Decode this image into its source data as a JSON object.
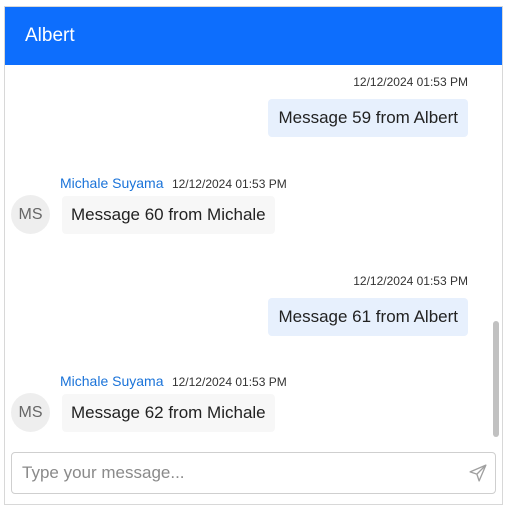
{
  "header": {
    "title": "Albert"
  },
  "messages": [
    {
      "direction": "outgoing",
      "timestamp": "12/12/2024 01:53 PM",
      "text": "Message 59 from Albert"
    },
    {
      "direction": "incoming",
      "sender": "Michale Suyama",
      "initials": "MS",
      "timestamp": "12/12/2024 01:53 PM",
      "text": "Message 60 from Michale"
    },
    {
      "direction": "outgoing",
      "timestamp": "12/12/2024 01:53 PM",
      "text": "Message 61 from Albert"
    },
    {
      "direction": "incoming",
      "sender": "Michale Suyama",
      "initials": "MS",
      "timestamp": "12/12/2024 01:53 PM",
      "text": "Message 62 from Michale"
    }
  ],
  "composer": {
    "placeholder": "Type your message...",
    "value": "",
    "send_icon": "send-icon"
  },
  "colors": {
    "header_bg": "#0d6efd",
    "outgoing_bubble": "#e7f0fd",
    "incoming_bubble": "#f7f7f7",
    "sender_name": "#1a73d9"
  }
}
